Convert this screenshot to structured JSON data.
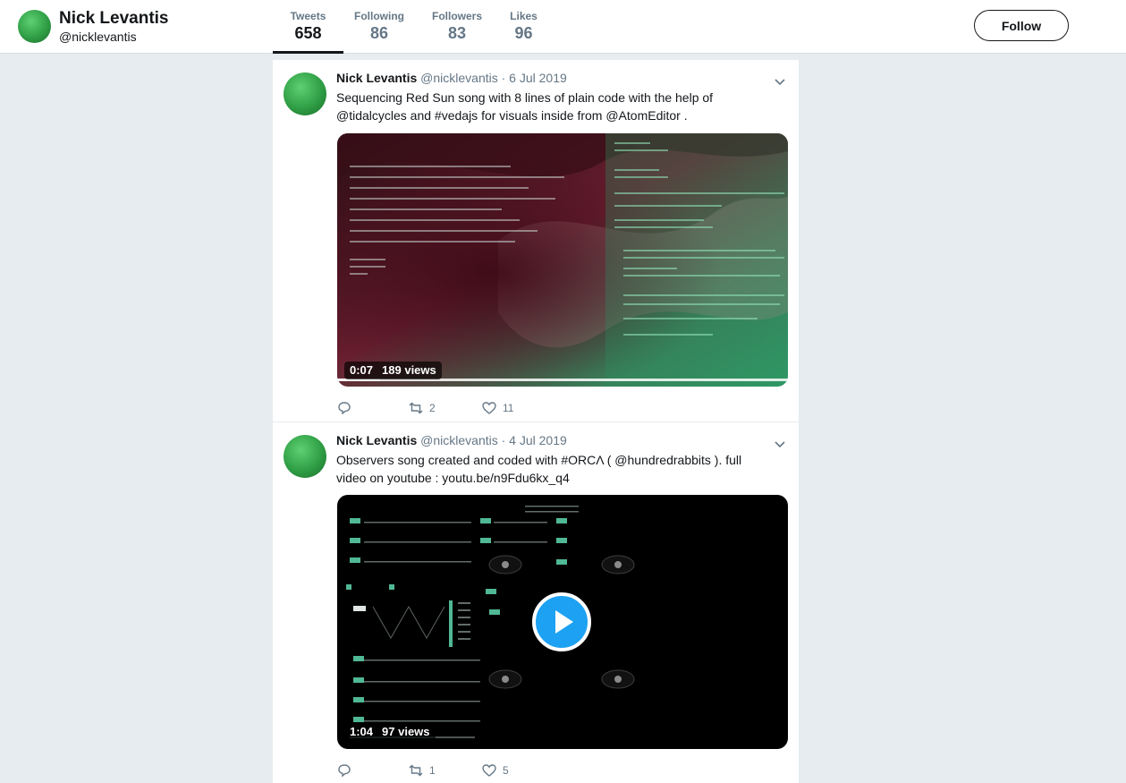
{
  "profile": {
    "name": "Nick Levantis",
    "handle": "@nicklevantis",
    "follow_label": "Follow"
  },
  "stats": [
    {
      "label": "Tweets",
      "value": "658"
    },
    {
      "label": "Following",
      "value": "86"
    },
    {
      "label": "Followers",
      "value": "83"
    },
    {
      "label": "Likes",
      "value": "96"
    }
  ],
  "tweets": [
    {
      "name": "Nick Levantis",
      "handle": "@nicklevantis",
      "date": "· 6 Jul 2019",
      "text": "Sequencing Red Sun song with 8 lines of plain code with the help of @tidalcycles and #vedajs for visuals inside from  @AtomEditor .",
      "duration": "0:07",
      "views": "189 views",
      "replies": "",
      "retweets": "2",
      "likes": "11"
    },
    {
      "name": "Nick Levantis",
      "handle": "@nicklevantis",
      "date": "· 4 Jul 2019",
      "text": "Observers  song  created and coded with #ORCΛ ( @hundredrabbits ).   full video on youtube : youtu.be/n9Fdu6kx_q4",
      "duration": "1:04",
      "views": "97 views",
      "replies": "",
      "retweets": "1",
      "likes": "5"
    }
  ],
  "colors": {
    "accent": "#1da1f2",
    "text_primary": "#14171a",
    "text_secondary": "#657786",
    "page_bg": "#e6ecf0"
  }
}
